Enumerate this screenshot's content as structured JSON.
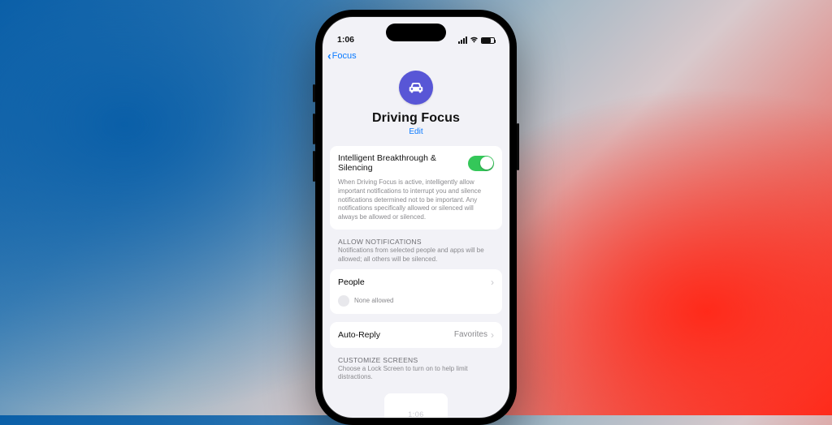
{
  "status": {
    "time": "1:06"
  },
  "nav": {
    "back": "Focus"
  },
  "hero": {
    "title": "Driving Focus",
    "edit": "Edit"
  },
  "intelligent": {
    "label": "Intelligent Breakthrough & Silencing",
    "desc": "When Driving Focus is active, intelligently allow important notifications to interrupt you and silence notifications determined not to be important. Any notifications specifically allowed or silenced will always be allowed or silenced.",
    "on": true
  },
  "allow": {
    "heading": "ALLOW NOTIFICATIONS",
    "sub": "Notifications from selected people and apps will be allowed; all others will be silenced."
  },
  "people": {
    "label": "People",
    "status": "None allowed"
  },
  "autoreply": {
    "label": "Auto-Reply",
    "value": "Favorites"
  },
  "customize": {
    "heading": "CUSTOMIZE SCREENS",
    "sub": "Choose a Lock Screen to turn on to help limit distractions."
  },
  "lock": {
    "time": "1:06"
  }
}
